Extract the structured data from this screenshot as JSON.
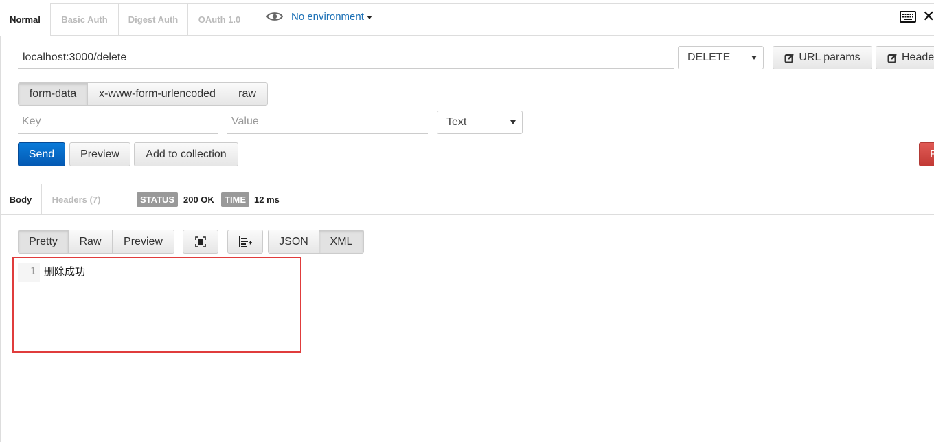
{
  "auth_tabs": [
    "Normal",
    "Basic Auth",
    "Digest Auth",
    "OAuth 1.0"
  ],
  "environment": {
    "label": "No environment"
  },
  "request": {
    "url": "localhost:3000/delete",
    "method": "DELETE",
    "url_params_label": "URL params",
    "headers_label": "Heade"
  },
  "body_modes": [
    "form-data",
    "x-www-form-urlencoded",
    "raw"
  ],
  "form": {
    "key_placeholder": "Key",
    "value_placeholder": "Value",
    "type": "Text"
  },
  "actions": {
    "send": "Send",
    "preview": "Preview",
    "add_to_collection": "Add to collection",
    "reset": "R"
  },
  "response": {
    "tabs": [
      "Body",
      "Headers (7)"
    ],
    "status_label": "STATUS",
    "status_value": "200 OK",
    "time_label": "TIME",
    "time_value": "12 ms",
    "view_modes": [
      "Pretty",
      "Raw",
      "Preview"
    ],
    "formats": [
      "JSON",
      "XML"
    ],
    "line_number": "1",
    "body_text": "删除成功"
  },
  "colors": {
    "send": "#0a6bc8",
    "link": "#1a6fb5",
    "highlight": "#e03c3c",
    "badge": "#999999"
  }
}
